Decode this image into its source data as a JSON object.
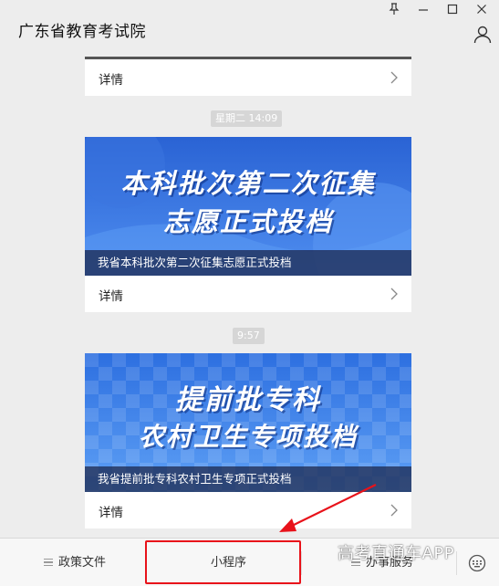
{
  "window": {
    "title": "广东省教育考试院"
  },
  "feed": {
    "top_card": {
      "detail_label": "详情"
    },
    "messages": [
      {
        "time": "星期二 14:09",
        "banner_lines": [
          "本科批次第二次征集",
          "志愿正式投档"
        ],
        "caption": "我省本科批次第二次征集志愿正式投档",
        "detail_label": "详情",
        "banner_colors": {
          "top": "#2a63d4",
          "bottom": "#4f8ef0"
        }
      },
      {
        "time": "9:57",
        "banner_lines": [
          "提前批专科",
          "农村卫生专项投档"
        ],
        "caption": "我省提前批专科农村卫生专项正式投档",
        "detail_label": "详情",
        "banner_colors": {
          "top": "#2d6fe0",
          "bottom": "#5ea0f5"
        }
      }
    ]
  },
  "tabbar": {
    "tabs": [
      {
        "label": "政策文件",
        "icon": "menu-icon"
      },
      {
        "label": "小程序"
      },
      {
        "label": "办事服务",
        "icon": "menu-icon"
      }
    ]
  },
  "annotation": {
    "highlight_color": "#e8121a"
  },
  "watermark": "高考直通车APP"
}
